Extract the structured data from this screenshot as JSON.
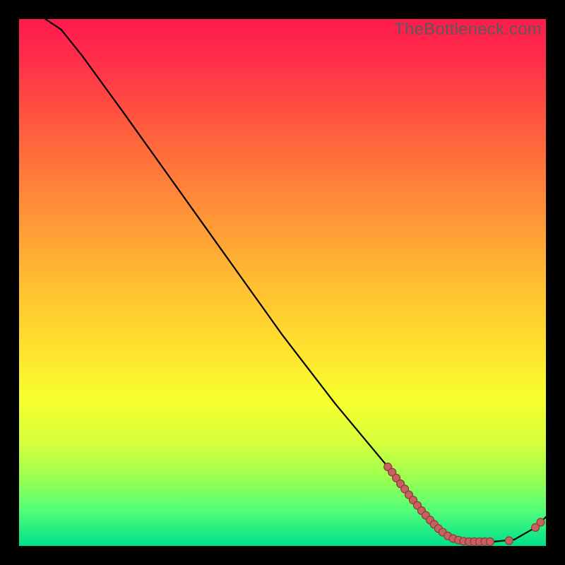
{
  "watermark": "TheBottleneck.com",
  "colors": {
    "background": "#000000",
    "line": "#000000",
    "dot_fill": "#c86060",
    "dot_stroke": "#8c3a3a"
  },
  "chart_data": {
    "type": "line",
    "title": "",
    "xlabel": "",
    "ylabel": "",
    "xlim": [
      0,
      100
    ],
    "ylim": [
      0,
      100
    ],
    "curve": [
      {
        "x": 5,
        "y": 100
      },
      {
        "x": 8,
        "y": 98
      },
      {
        "x": 12,
        "y": 93
      },
      {
        "x": 20,
        "y": 82
      },
      {
        "x": 30,
        "y": 68
      },
      {
        "x": 40,
        "y": 54
      },
      {
        "x": 50,
        "y": 40
      },
      {
        "x": 60,
        "y": 27
      },
      {
        "x": 70,
        "y": 15
      },
      {
        "x": 78,
        "y": 5
      },
      {
        "x": 82,
        "y": 1.5
      },
      {
        "x": 86,
        "y": 0.8
      },
      {
        "x": 90,
        "y": 0.8
      },
      {
        "x": 94,
        "y": 1.2
      },
      {
        "x": 98,
        "y": 3.5
      },
      {
        "x": 100,
        "y": 5.5
      }
    ],
    "markers": [
      {
        "x": 70.0,
        "y": 15.0
      },
      {
        "x": 70.8,
        "y": 14.0
      },
      {
        "x": 71.6,
        "y": 12.9
      },
      {
        "x": 72.4,
        "y": 11.8
      },
      {
        "x": 73.2,
        "y": 10.8
      },
      {
        "x": 74.0,
        "y": 9.7
      },
      {
        "x": 74.8,
        "y": 8.7
      },
      {
        "x": 75.6,
        "y": 7.7
      },
      {
        "x": 76.4,
        "y": 6.7
      },
      {
        "x": 77.2,
        "y": 5.8
      },
      {
        "x": 78.0,
        "y": 4.9
      },
      {
        "x": 78.8,
        "y": 4.1
      },
      {
        "x": 79.6,
        "y": 3.3
      },
      {
        "x": 80.4,
        "y": 2.6
      },
      {
        "x": 81.4,
        "y": 1.9
      },
      {
        "x": 82.4,
        "y": 1.4
      },
      {
        "x": 83.4,
        "y": 1.1
      },
      {
        "x": 84.4,
        "y": 0.9
      },
      {
        "x": 85.4,
        "y": 0.8
      },
      {
        "x": 86.4,
        "y": 0.8
      },
      {
        "x": 87.4,
        "y": 0.8
      },
      {
        "x": 88.4,
        "y": 0.8
      },
      {
        "x": 89.4,
        "y": 0.8
      },
      {
        "x": 93.0,
        "y": 1.0
      },
      {
        "x": 98.0,
        "y": 3.5
      },
      {
        "x": 99.0,
        "y": 4.5
      }
    ]
  }
}
